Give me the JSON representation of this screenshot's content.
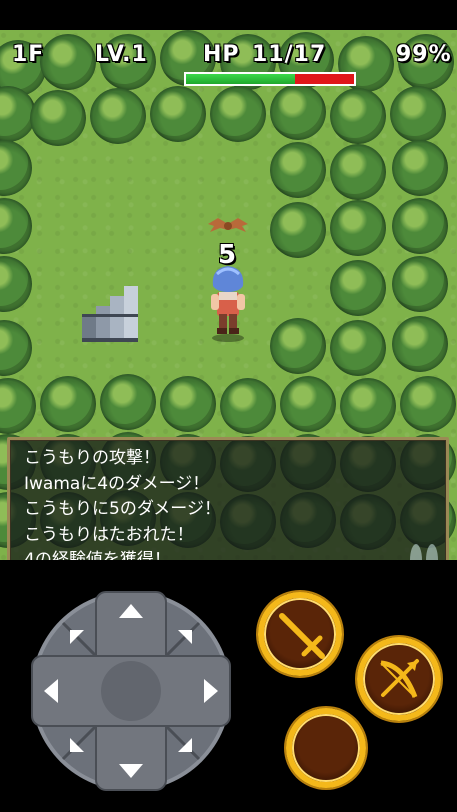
{
  "hud": {
    "floor": "1F",
    "level": "LV.1",
    "hp_label": "HP",
    "hp_value": "11/17",
    "hp_fraction": 0.647,
    "fullness": "99%"
  },
  "damage_popup": "5",
  "message_log": [
    "こうもりの攻撃！",
    "Iwamaに4のダメージ！",
    "こうもりに5のダメージ！",
    "こうもりはたおれた！",
    "4の経験値を獲得！"
  ],
  "colors": {
    "hp_full": "#2ec83c",
    "hp_empty": "#e0161a",
    "button_ring": "#f4b81a",
    "message_border": "#9b8a55"
  },
  "controls": {
    "dpad_icon": "dpad-arrows",
    "attack_icon": "sword-icon",
    "shoot_icon": "bow-icon",
    "menu_icon": "empty-button"
  }
}
